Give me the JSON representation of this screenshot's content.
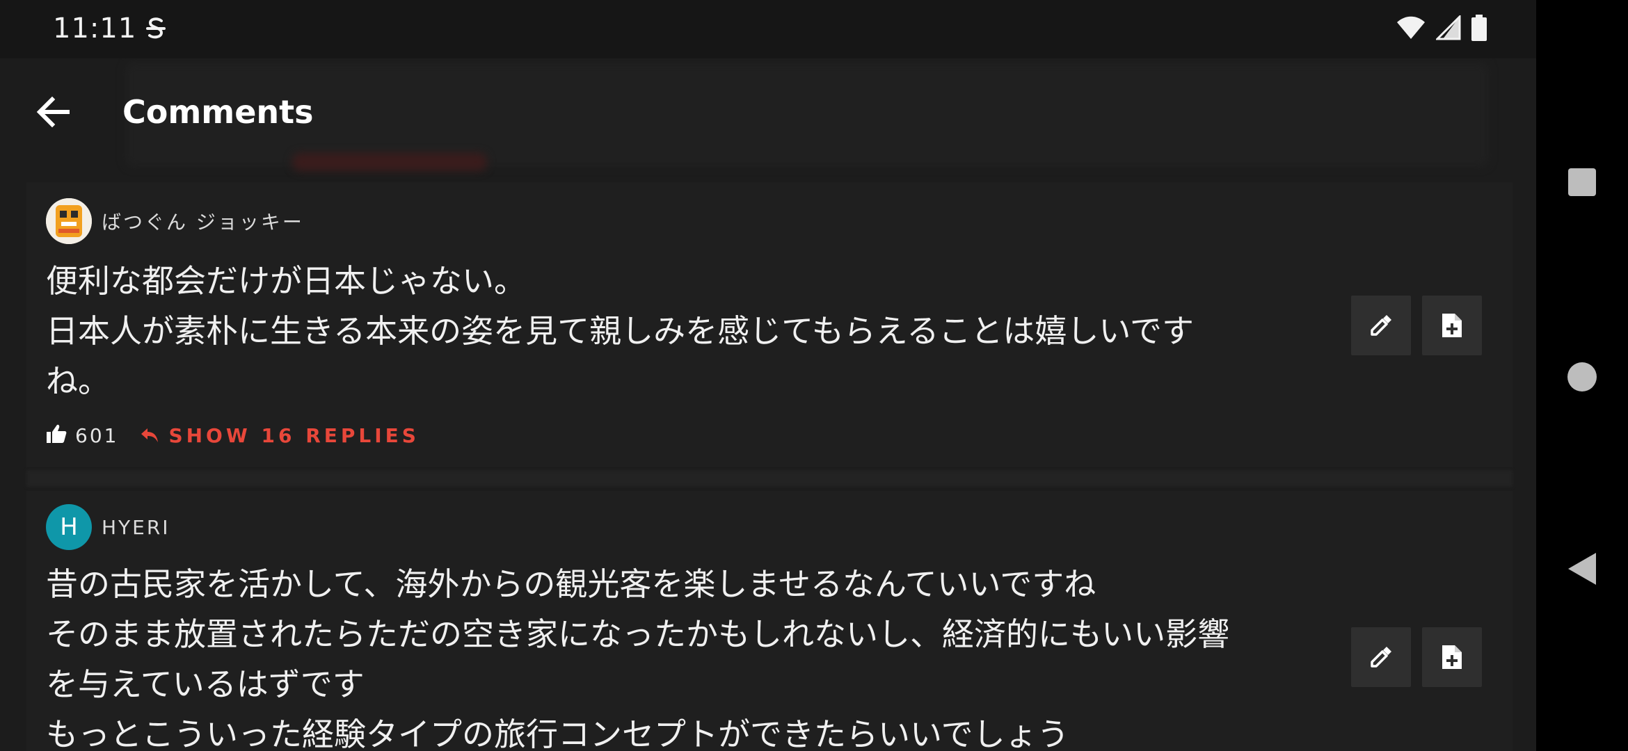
{
  "status_bar": {
    "time": "11:11"
  },
  "header": {
    "title": "Comments"
  },
  "comments": [
    {
      "author": "ばつぐん ジョッキー",
      "avatar_type": "image",
      "text": "便利な都会だけが日本じゃない。\n日本人が素朴に生きる本来の姿を見て親しみを感じてもらえることは嬉しいです\nね。",
      "likes": "601",
      "replies_label": "SHOW 16 REPLIES"
    },
    {
      "author": "HYERI",
      "avatar_letter": "H",
      "avatar_color": "#0f97a9",
      "text": "昔の古民家を活かして、海外からの観光客を楽しませるなんていいですね\nそのまま放置されたらただの空き家になったかもしれないし、経済的にもいい影響\nを与えているはずです\nもっとこういった経験タイプの旅行コンセプトができたらいいでしょう"
    }
  ],
  "icons": {
    "back": "arrow-left-icon",
    "like": "thumbs-up-icon",
    "reply": "reply-arrow-icon",
    "pick": "eyedropper-icon",
    "add_note": "file-plus-icon",
    "nav_recents": "square-icon",
    "nav_home": "circle-icon",
    "nav_back": "triangle-back-icon"
  },
  "colors": {
    "accent": "#e8473a",
    "background": "#1c1c1c",
    "card": "#1f1f1f"
  }
}
